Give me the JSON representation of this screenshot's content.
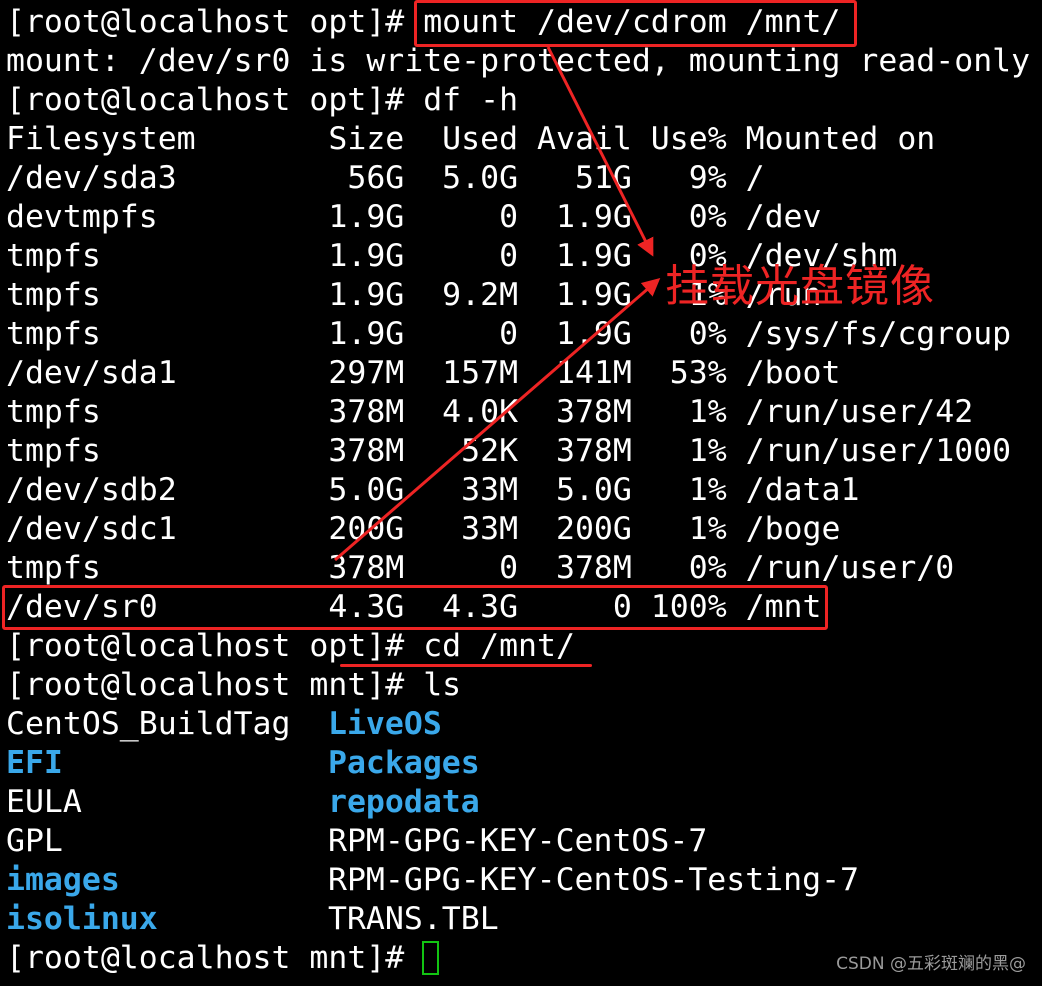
{
  "terminal": {
    "lines": [
      "[root@localhost opt]# mount /dev/cdrom /mnt/",
      "mount: /dev/sr0 is write-protected, mounting read-only",
      "[root@localhost opt]# df -h",
      "Filesystem       Size  Used Avail Use% Mounted on",
      "/dev/sda3         56G  5.0G   51G   9% /",
      "devtmpfs         1.9G     0  1.9G   0% /dev",
      "tmpfs            1.9G     0  1.9G   0% /dev/shm",
      "tmpfs            1.9G  9.2M  1.9G   1% /run",
      "tmpfs            1.9G     0  1.9G   0% /sys/fs/cgroup",
      "/dev/sda1        297M  157M  141M  53% /boot",
      "tmpfs            378M  4.0K  378M   1% /run/user/42",
      "tmpfs            378M   52K  378M   1% /run/user/1000",
      "/dev/sdb2        5.0G   33M  5.0G   1% /data1",
      "/dev/sdc1        200G   33M  200G   1% /boge",
      "tmpfs            378M     0  378M   0% /run/user/0",
      "/dev/sr0         4.3G  4.3G     0 100% /mnt",
      "[root@localhost opt]# cd /mnt/",
      "[root@localhost mnt]# ls"
    ],
    "ls_output": [
      {
        "left": "CentOS_BuildTag",
        "right": "LiveOS"
      },
      {
        "left": "EFI",
        "right": "Packages"
      },
      {
        "left": "EULA",
        "right": "repodata"
      },
      {
        "left": "GPL",
        "right": "RPM-GPG-KEY-CentOS-7"
      },
      {
        "left": "images",
        "right": "RPM-GPG-KEY-CentOS-Testing-7"
      },
      {
        "left": "isolinux",
        "right": "TRANS.TBL"
      }
    ],
    "final_prompt": "[root@localhost mnt]# "
  },
  "annotation": {
    "text": "挂载光盘镜像"
  },
  "watermark": "CSDN @五彩斑斓的黑@",
  "colors": {
    "background": "#000000",
    "text": "#ffffff",
    "directory": "#3aa8ea",
    "annotation": "#ee2424",
    "cursor": "#12c412"
  }
}
